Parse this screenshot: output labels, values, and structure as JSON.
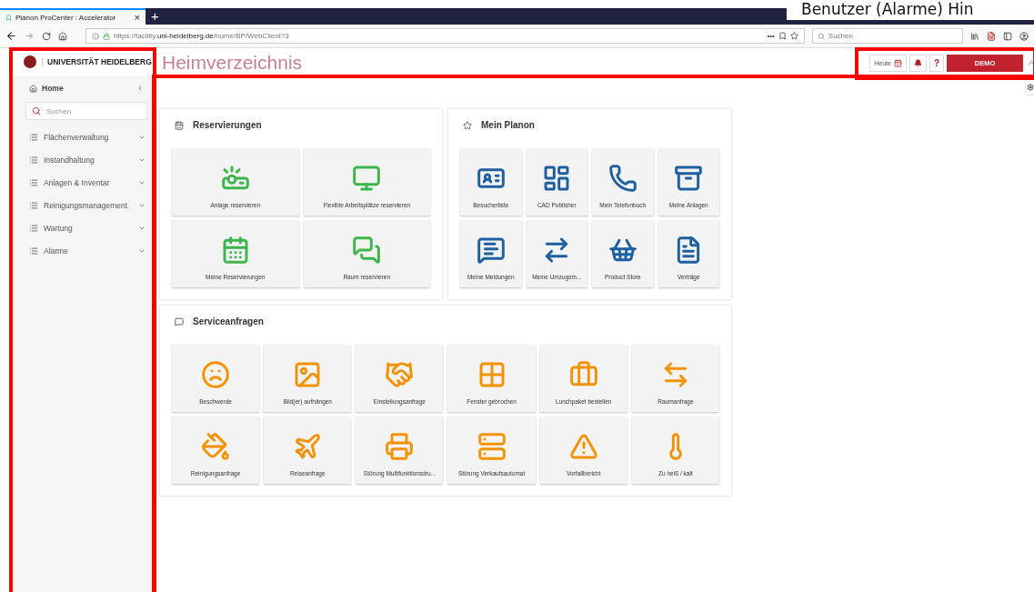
{
  "browser": {
    "tab_title": "Planon ProCenter : Accelerator",
    "tab_close": "×",
    "new_tab": "+",
    "url_prefix": "https://facility.",
    "url_domain": "uni-heidelberg.de",
    "url_path": "/home/BP/WebClient?3",
    "page_actions": "•••",
    "search_placeholder": "Suchen"
  },
  "caption": "Benutzer (Alarme) Hin",
  "sidebar": {
    "brand": "UNIVERSITÄT HEIDELBERG",
    "home": "Home",
    "search_placeholder": "Suchen",
    "items": [
      {
        "label": "Flächenverwaltung"
      },
      {
        "label": "Instandhaltung"
      },
      {
        "label": "Anlagen & Inventar"
      },
      {
        "label": "Reinigungsmanagement"
      },
      {
        "label": "Wartung"
      },
      {
        "label": "Alarme"
      }
    ]
  },
  "header": {
    "title": "Heimverzeichnis",
    "today": "Heute",
    "help": "?",
    "demo": "DEMO",
    "user": "A"
  },
  "sections": [
    {
      "title": "Reservierungen",
      "color": "#3cb54a",
      "tiles": [
        "Anlage reservieren",
        "Flexible Arbeitsplätze reservieren",
        "Meine Reservierungen",
        "Raum reservieren"
      ]
    },
    {
      "title": "Mein Planon",
      "color": "#1e5fa0",
      "tiles": [
        "Besucherliste",
        "CAD Publisher",
        "Mein Telefonbuch",
        "Meine Anlagen",
        "Meine Meldungen",
        "Meine Umzugsm...",
        "Product Store",
        "Verträge"
      ]
    },
    {
      "title": "Serviceanfragen",
      "color": "#f39200",
      "tiles": [
        "Beschwerde",
        "Bild(er) aufhängen",
        "Einstellungsanfrage",
        "Fenster gebrochen",
        "Lunchpaket bestellen",
        "Raumanfrage",
        "Reinigungsanfrage",
        "Reiseanfrage",
        "Störung Multifunktionsdru...",
        "Störung Verkaufsautomat",
        "Vorfallbericht",
        "Zu heiß / kalt"
      ]
    }
  ]
}
